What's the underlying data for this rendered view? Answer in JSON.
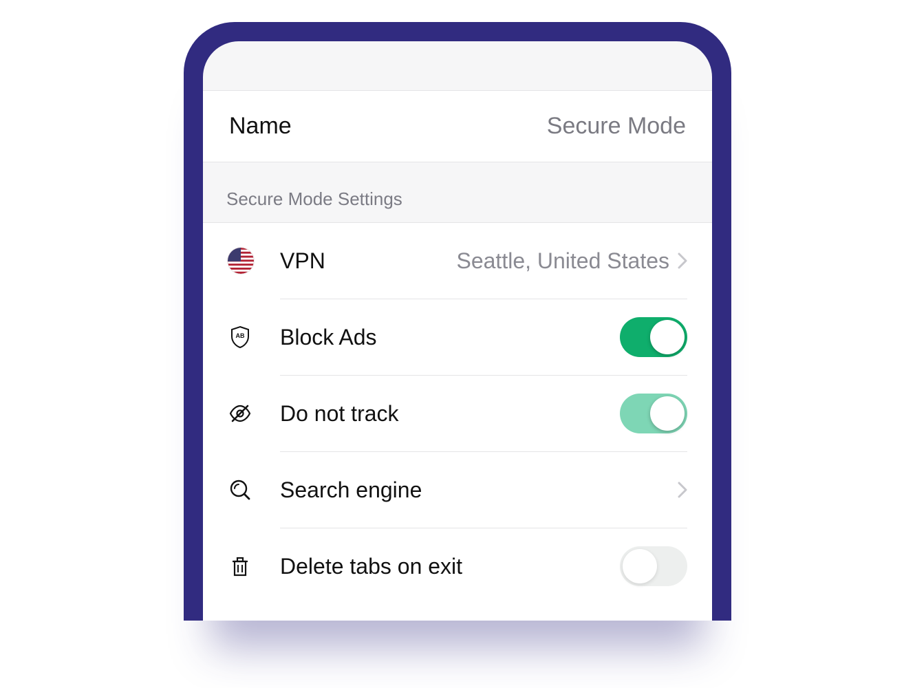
{
  "header": {
    "name_label": "Name",
    "name_value": "Secure Mode"
  },
  "section": {
    "title": "Secure Mode Settings"
  },
  "rows": {
    "vpn": {
      "label": "VPN",
      "value": "Seattle, United States"
    },
    "block_ads": {
      "label": "Block Ads",
      "enabled": true
    },
    "do_not_track": {
      "label": "Do not track",
      "enabled": true
    },
    "search_engine": {
      "label": "Search engine"
    },
    "delete_tabs": {
      "label": "Delete tabs on exit",
      "enabled": false
    }
  },
  "colors": {
    "frame": "#312B80",
    "toggle_on": "#0FAE6C",
    "toggle_on_faded": "#7ED6B5",
    "toggle_off": "#EDEFEE"
  }
}
